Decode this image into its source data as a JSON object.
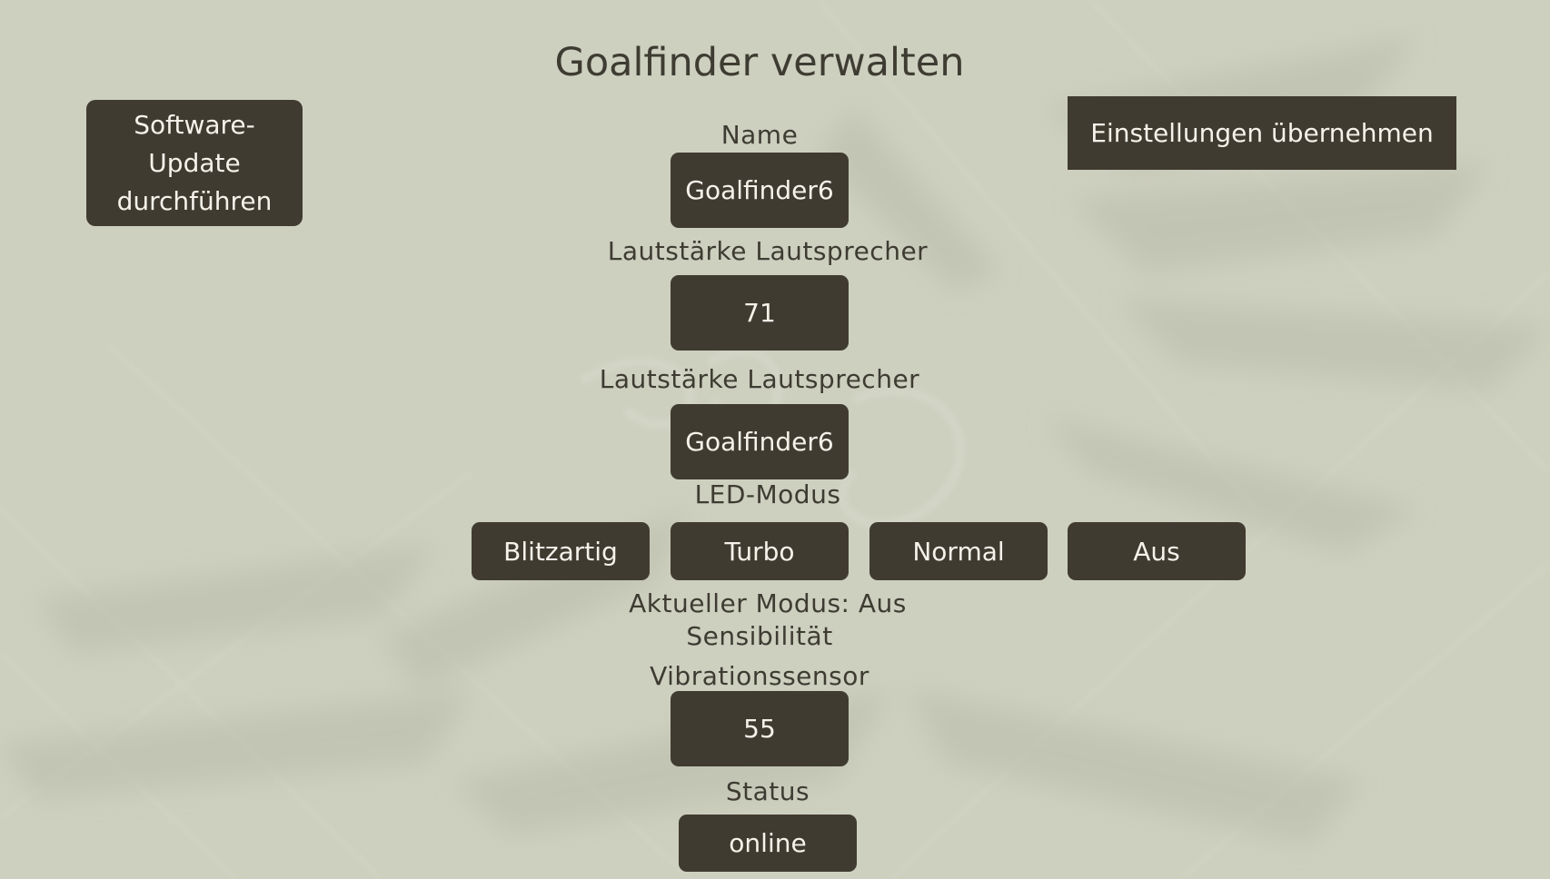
{
  "page": {
    "title": "Goalfinder verwalten"
  },
  "toolbar": {
    "software_update_line1": "Software-",
    "software_update_line2": "Update",
    "software_update_line3": "durchführen",
    "apply_settings_label": "Einstellungen übernehmen"
  },
  "fields": {
    "name_label": "Name",
    "name_value": "Goalfinder6",
    "speaker_volume_label": "Lautstärke Lautsprecher",
    "speaker_volume_value": "71",
    "speaker_volume_label_2": "Lautstärke Lautsprecher",
    "speaker_volume_value_2": "Goalfinder6",
    "led_mode_label": "LED-Modus",
    "led_modes": [
      "Blitzartig",
      "Turbo",
      "Normal",
      "Aus"
    ],
    "current_mode_text": "Aktueller Modus: Aus",
    "sensitivity_label": "Sensibilität",
    "vibration_sensor_label": "Vibrationssensor",
    "vibration_sensor_value": "55",
    "status_label": "Status",
    "status_value": "online"
  },
  "colors": {
    "background": "#cdcfbf",
    "button": "#403b30",
    "button_text": "#f4f2ea",
    "text": "#3e3c32"
  }
}
